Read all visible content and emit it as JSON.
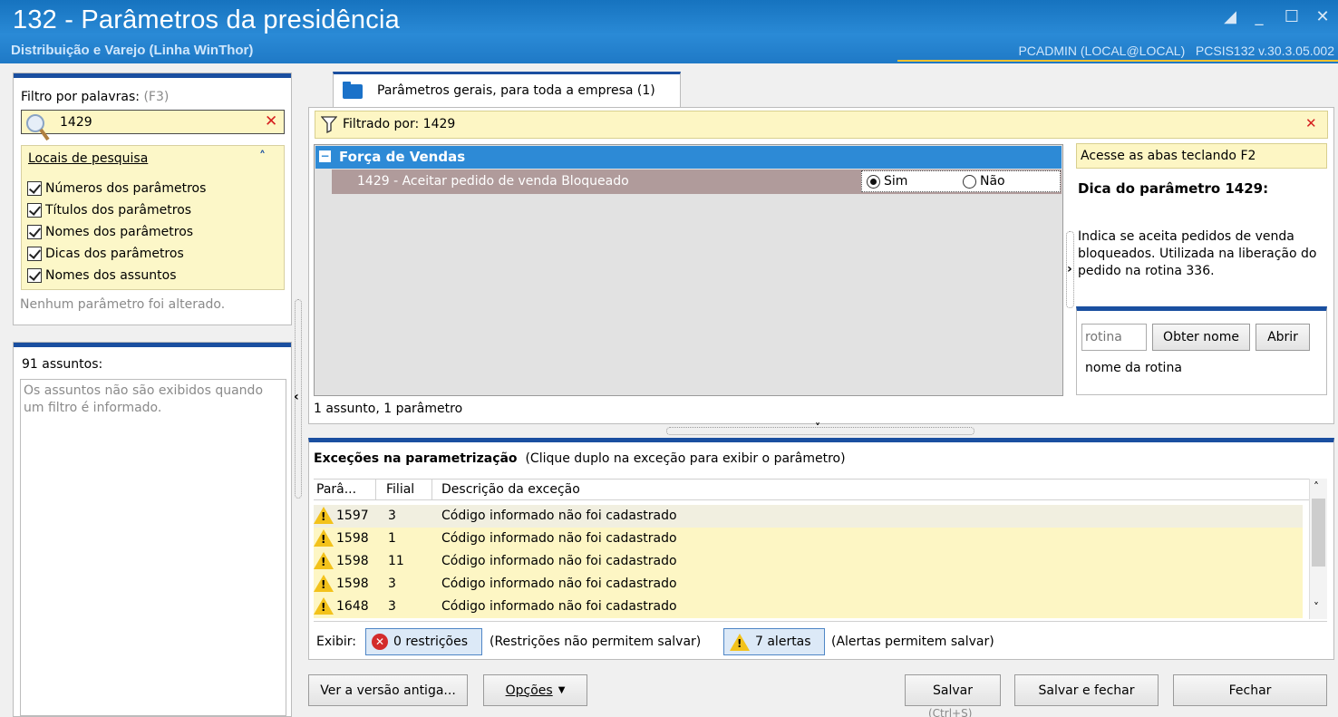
{
  "window": {
    "title": "132 - Parâmetros da presidência",
    "subtitle": "Distribuição e Varejo (Linha WinThor)",
    "user_info": "PCADMIN (LOCAL@LOCAL)",
    "version_info": "PCSIS132  v.30.3.05.002"
  },
  "left": {
    "filter_label": "Filtro por palavras:",
    "filter_shortcut": "(F3)",
    "search_value": "1429",
    "locais_title": "Locais de pesquisa",
    "checkboxes": [
      {
        "label": "Números dos parâmetros",
        "checked": true
      },
      {
        "label": "Títulos dos parâmetros",
        "checked": true
      },
      {
        "label": "Nomes dos parâmetros",
        "checked": true
      },
      {
        "label": "Dicas dos parâmetros",
        "checked": true
      },
      {
        "label": "Nomes dos assuntos",
        "checked": true
      }
    ],
    "no_change_text": "Nenhum parâmetro foi alterado.",
    "subjects_count": "91 assuntos:",
    "subjects_note_1": "Os assuntos não são exibidos quando",
    "subjects_note_2": "um filtro é informado."
  },
  "tab": {
    "label": "Parâmetros gerais, para toda a empresa  (1)"
  },
  "filter_bar": {
    "text": "Filtrado por: 1429"
  },
  "grid": {
    "group": "Força de Vendas",
    "row_label": "1429 - Aceitar pedido de venda Bloqueado",
    "option_yes": "Sim",
    "option_no": "Não",
    "selected": "Sim",
    "summary": "1 assunto, 1 parâmetro"
  },
  "side": {
    "hint_tabs": "Acesse as abas teclando F2",
    "tip_title": "Dica do parâmetro 1429:",
    "tip_line1": "Indica se aceita pedidos de venda",
    "tip_line2": "bloqueados. Utilizada na liberação do",
    "tip_line3": "pedido na rotina 336.",
    "rotina_placeholder": "rotina",
    "btn_obter": "Obter nome",
    "btn_abrir": "Abrir",
    "rotina_name": "nome da rotina"
  },
  "exceptions": {
    "title": "Exceções na parametrização",
    "hint": "(Clique duplo na exceção para exibir o parâmetro)",
    "columns": [
      "Parâ...",
      "Filial",
      "Descrição da exceção"
    ],
    "rows": [
      {
        "param": "1597",
        "filial": "3",
        "desc": "Código informado não foi cadastrado"
      },
      {
        "param": "1598",
        "filial": "1",
        "desc": "Código informado não foi cadastrado"
      },
      {
        "param": "1598",
        "filial": "11",
        "desc": "Código informado não foi cadastrado"
      },
      {
        "param": "1598",
        "filial": "3",
        "desc": "Código informado não foi cadastrado"
      },
      {
        "param": "1648",
        "filial": "3",
        "desc": "Código informado não foi cadastrado"
      }
    ],
    "exibir_label": "Exibir:",
    "restrictions_btn": "0 restrições",
    "restrictions_note": "(Restrições não permitem salvar)",
    "alerts_btn": "7 alertas",
    "alerts_note": "(Alertas permitem salvar)"
  },
  "footer": {
    "old_version": "Ver a versão antiga...",
    "options": "Opções",
    "save": "Salvar",
    "save_shortcut": "(Ctrl+S)",
    "save_close": "Salvar e fechar",
    "close": "Fechar"
  },
  "colors": {
    "accent": "#1a4fa0",
    "title_bar": "#2a8ad6",
    "highlight": "#fdf6c4",
    "group_header": "#2d8ad6"
  },
  "icons": [
    "search-icon",
    "clear-icon",
    "collapse-icon",
    "filter-icon",
    "folder-icon",
    "warning-icon",
    "error-icon",
    "dropdown-icon"
  ]
}
